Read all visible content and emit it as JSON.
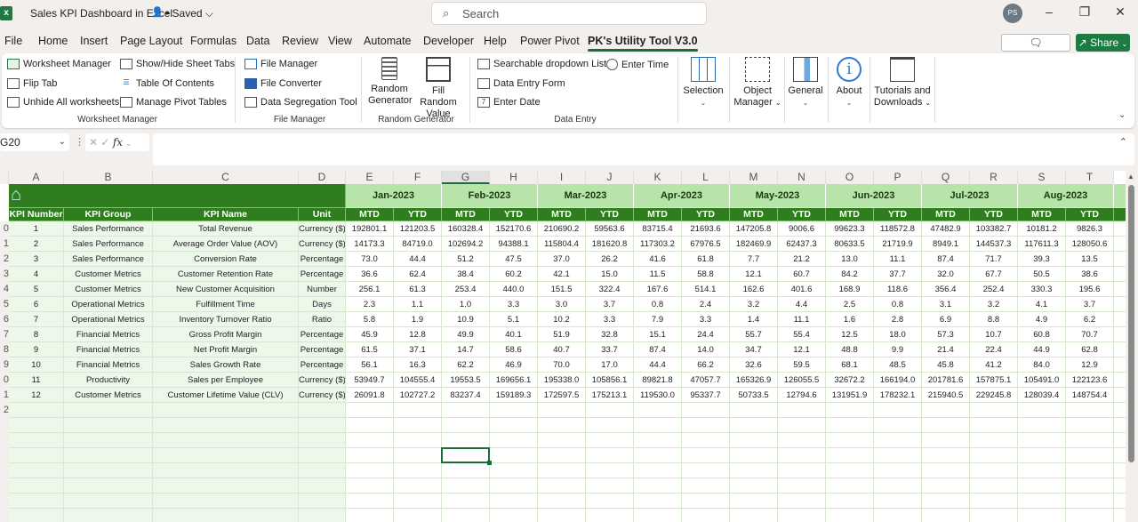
{
  "titlebar": {
    "app_icon": "excel-logo",
    "doc_title": "Sales KPI Dashboard in Excel",
    "share_icon": "people-icon",
    "saved_status": "• Saved ⌵",
    "search_placeholder": "Search",
    "avatar_initials": "PS",
    "minimize": "–",
    "restore": "❐",
    "close": "✕"
  },
  "menu": {
    "tabs": [
      "File",
      "Home",
      "Insert",
      "Page Layout",
      "Formulas",
      "Data",
      "Review",
      "View",
      "Automate",
      "Developer",
      "Help",
      "Power Pivot",
      "PK's Utility Tool V3.0"
    ],
    "active_tab": "PK's Utility Tool V3.0",
    "comments_label": "Comments",
    "share_label": "Share"
  },
  "ribbon": {
    "worksheet_manager": {
      "items": [
        "Worksheet Manager",
        "Flip Tab",
        "Unhide All worksheets",
        "Show/Hide Sheet Tabs",
        "Table Of Contents",
        "Manage Pivot Tables"
      ],
      "group_label": "Worksheet Manager"
    },
    "file_manager": {
      "items": [
        "File Manager",
        "File Converter",
        "Data Segregation Tool"
      ],
      "group_label": "File Manager"
    },
    "random_generator": {
      "items": [
        "Random Generator",
        "Fill Random Value"
      ],
      "group_label": "Random Generator"
    },
    "data_entry": {
      "items": [
        "Searchable dropdown List",
        "Data Entry Form",
        "Enter Date",
        "Enter Time"
      ],
      "group_label": "Data Entry"
    },
    "big_buttons": [
      "Selection",
      "Object Manager",
      "General",
      "About",
      "Tutorials and Downloads"
    ]
  },
  "formula_bar": {
    "name_box": "G20",
    "formula": ""
  },
  "sheet": {
    "column_letters": [
      "A",
      "B",
      "C",
      "D",
      "E",
      "F",
      "G",
      "H",
      "I",
      "J",
      "K",
      "L",
      "M",
      "N",
      "O",
      "P",
      "Q",
      "R",
      "S",
      "T"
    ],
    "row_numbers": [
      "",
      "",
      "",
      "",
      "",
      "",
      "",
      "",
      "0",
      "1",
      "2",
      "3",
      "4",
      "5",
      "6",
      "7",
      "8",
      "9",
      "0",
      "1",
      "2"
    ],
    "headers": [
      "KPI Number",
      "KPI Group",
      "KPI Name",
      "Unit"
    ],
    "months": [
      "Jan-2023",
      "Feb-2023",
      "Mar-2023",
      "Apr-2023",
      "May-2023",
      "Jun-2023",
      "Jul-2023",
      "Aug-2023"
    ],
    "sub_headers": [
      "MTD",
      "YTD"
    ],
    "selected_cell": "G20",
    "rows": [
      {
        "num": "1",
        "group": "Sales Performance",
        "name": "Total Revenue",
        "unit": "Currency ($)",
        "values": [
          "192801.1",
          "121203.5",
          "160328.4",
          "152170.6",
          "210690.2",
          "59563.6",
          "83715.4",
          "21693.6",
          "147205.8",
          "9006.6",
          "99623.3",
          "118572.8",
          "47482.9",
          "103382.7",
          "10181.2",
          "9826.3"
        ]
      },
      {
        "num": "2",
        "group": "Sales Performance",
        "name": "Average Order Value (AOV)",
        "unit": "Currency ($)",
        "values": [
          "14173.3",
          "84719.0",
          "102694.2",
          "94388.1",
          "115804.4",
          "181620.8",
          "117303.2",
          "67976.5",
          "182469.9",
          "62437.3",
          "80633.5",
          "21719.9",
          "8949.1",
          "144537.3",
          "117611.3",
          "128050.6"
        ]
      },
      {
        "num": "3",
        "group": "Sales Performance",
        "name": "Conversion Rate",
        "unit": "Percentage",
        "values": [
          "73.0",
          "44.4",
          "51.2",
          "47.5",
          "37.0",
          "26.2",
          "41.6",
          "61.8",
          "7.7",
          "21.2",
          "13.0",
          "11.1",
          "87.4",
          "71.7",
          "39.3",
          "13.5"
        ]
      },
      {
        "num": "4",
        "group": "Customer Metrics",
        "name": "Customer Retention Rate",
        "unit": "Percentage",
        "values": [
          "36.6",
          "62.4",
          "38.4",
          "60.2",
          "42.1",
          "15.0",
          "11.5",
          "58.8",
          "12.1",
          "60.7",
          "84.2",
          "37.7",
          "32.0",
          "67.7",
          "50.5",
          "38.6"
        ]
      },
      {
        "num": "5",
        "group": "Customer Metrics",
        "name": "New Customer Acquisition",
        "unit": "Number",
        "values": [
          "256.1",
          "61.3",
          "253.4",
          "440.0",
          "151.5",
          "322.4",
          "167.6",
          "514.1",
          "162.6",
          "401.6",
          "168.9",
          "118.6",
          "356.4",
          "252.4",
          "330.3",
          "195.6"
        ]
      },
      {
        "num": "6",
        "group": "Operational Metrics",
        "name": "Fulfillment Time",
        "unit": "Days",
        "values": [
          "2.3",
          "1.1",
          "1.0",
          "3.3",
          "3.0",
          "3.7",
          "0.8",
          "2.4",
          "3.2",
          "4.4",
          "2.5",
          "0.8",
          "3.1",
          "3.2",
          "4.1",
          "3.7"
        ]
      },
      {
        "num": "7",
        "group": "Operational Metrics",
        "name": "Inventory Turnover Ratio",
        "unit": "Ratio",
        "values": [
          "5.8",
          "1.9",
          "10.9",
          "5.1",
          "10.2",
          "3.3",
          "7.9",
          "3.3",
          "1.4",
          "11.1",
          "1.6",
          "2.8",
          "6.9",
          "8.8",
          "4.9",
          "6.2"
        ]
      },
      {
        "num": "8",
        "group": "Financial Metrics",
        "name": "Gross Profit Margin",
        "unit": "Percentage",
        "values": [
          "45.9",
          "12.8",
          "49.9",
          "40.1",
          "51.9",
          "32.8",
          "15.1",
          "24.4",
          "55.7",
          "55.4",
          "12.5",
          "18.0",
          "57.3",
          "10.7",
          "60.8",
          "70.7"
        ]
      },
      {
        "num": "9",
        "group": "Financial Metrics",
        "name": "Net Profit Margin",
        "unit": "Percentage",
        "values": [
          "61.5",
          "37.1",
          "14.7",
          "58.6",
          "40.7",
          "33.7",
          "87.4",
          "14.0",
          "34.7",
          "12.1",
          "48.8",
          "9.9",
          "21.4",
          "22.4",
          "44.9",
          "62.8"
        ]
      },
      {
        "num": "10",
        "group": "Financial Metrics",
        "name": "Sales Growth Rate",
        "unit": "Percentage",
        "values": [
          "56.1",
          "16.3",
          "62.2",
          "46.9",
          "70.0",
          "17.0",
          "44.4",
          "66.2",
          "32.6",
          "59.5",
          "68.1",
          "48.5",
          "45.8",
          "41.2",
          "84.0",
          "12.9"
        ]
      },
      {
        "num": "11",
        "group": "Productivity",
        "name": "Sales per Employee",
        "unit": "Currency ($)",
        "values": [
          "53949.7",
          "104555.4",
          "19553.5",
          "169656.1",
          "195338.0",
          "105856.1",
          "89821.8",
          "47057.7",
          "165326.9",
          "126055.5",
          "32672.2",
          "166194.0",
          "201781.6",
          "157875.1",
          "105491.0",
          "122123.6"
        ]
      },
      {
        "num": "12",
        "group": "Customer Metrics",
        "name": "Customer Lifetime Value (CLV)",
        "unit": "Currency ($)",
        "values": [
          "26091.8",
          "102727.2",
          "83237.4",
          "159189.3",
          "172597.5",
          "175213.1",
          "119530.0",
          "95337.7",
          "50733.5",
          "12794.6",
          "131951.9",
          "178232.1",
          "215940.5",
          "229245.8",
          "128039.4",
          "148754.4"
        ]
      }
    ]
  },
  "colors": {
    "header_dark_green": "#2f7d1f",
    "month_light_green": "#b7e4a8",
    "left_area_tint": "#eef8ea",
    "excel_green": "#1d7a43"
  }
}
